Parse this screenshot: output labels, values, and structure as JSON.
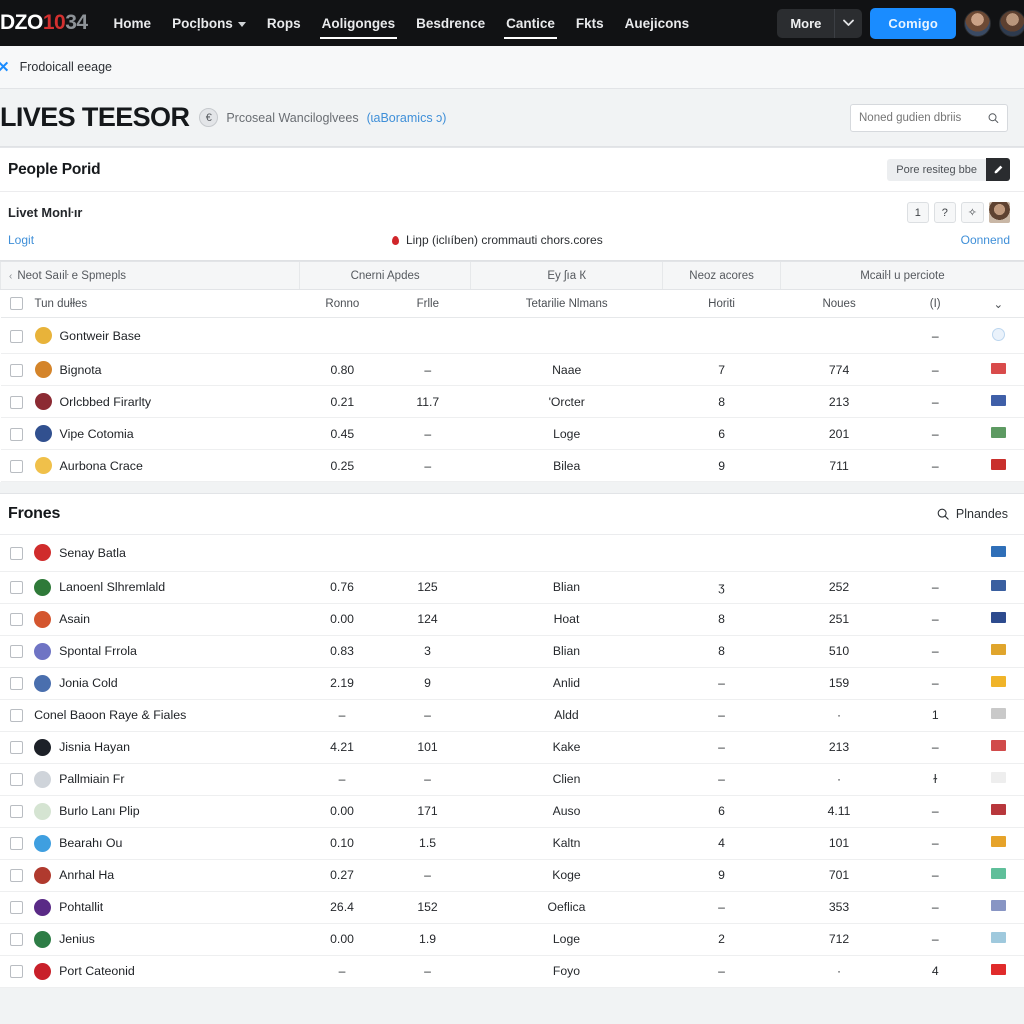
{
  "topnav": {
    "brand": {
      "part1": "DZO",
      "part2": "10",
      "part3": "34"
    },
    "links": [
      {
        "label": "Home",
        "active": false,
        "caret": false
      },
      {
        "label": "Pocḷbons",
        "active": false,
        "caret": true
      },
      {
        "label": "Rops",
        "active": false,
        "caret": false
      },
      {
        "label": "Aoligonges",
        "active": true,
        "caret": false
      },
      {
        "label": "Besdrence",
        "active": false,
        "caret": false
      },
      {
        "label": "Cantice",
        "active": true,
        "caret": false
      },
      {
        "label": "Fkts",
        "active": false,
        "caret": false
      },
      {
        "label": "Auejicons",
        "active": false,
        "caret": false
      }
    ],
    "more_label": "More",
    "cta_label": "Comigo",
    "avatar_name": "user-avatar",
    "avatar2_name": "secondary-avatar"
  },
  "notice": {
    "close_icon": "✕",
    "text": "Frodoicall eeage"
  },
  "titlebar": {
    "title": "LIVES TEESOR",
    "badge": "€",
    "subtitle": "Prcoseal Wanciloglvees",
    "link": "(ɩaBoramics ɔ)",
    "search_placeholder": "Noned gudien dbriis",
    "search_value": ""
  },
  "card1": {
    "heading": "People Porid",
    "chip_label": "Pore resiteg bbe",
    "chip_icon": "pencil-icon",
    "sub_heading": "Livet Monŀır",
    "mini_buttons": [
      "1",
      "?",
      "✧"
    ],
    "note_left": "Logit",
    "note_mid": "Liŋp (iclıíben) crommauti chors.cores",
    "note_right": "Oonnend"
  },
  "table": {
    "group_headers": [
      {
        "label": "Neot Saıiŀ e Spmepls",
        "chev": "‹"
      },
      {
        "label": "Cnerni Apdes"
      },
      {
        "label": "Ey ʃıа К"
      },
      {
        "label": "Neoz acores"
      },
      {
        "label": "Mcaiŀl u perciote"
      }
    ],
    "column_headers": {
      "checkbox": "",
      "name": "Tun dułłes",
      "num1": "Ronno",
      "num2": "Frlle",
      "team": "Tetarilie Nlmans",
      "h": "Horiti",
      "n": "Noues",
      "o": "(I)",
      "flag": "⌄"
    },
    "rows": [
      {
        "name": "Gontweir Base",
        "badge": "#e8b33a",
        "num1": "",
        "num2": "",
        "team": "",
        "h": "",
        "n": "",
        "o": "–",
        "flag": "#bcd6ef",
        "flagshape": "circle"
      },
      {
        "name": "Bignota",
        "badge": "#d4842a",
        "num1": "0.80",
        "num2": "–",
        "team": "Naae",
        "h": "7",
        "n": "774",
        "o": "–",
        "flag": "#d94b4b"
      },
      {
        "name": "Orlcbbed Firarlty",
        "badge": "#8c2b33",
        "num1": "0.21",
        "num2": "11.7",
        "team": "'Orcter",
        "h": "8",
        "n": "213",
        "o": "–",
        "flag": "#3f5fa8"
      },
      {
        "name": "Vipe Cotomia",
        "badge": "#31508f",
        "num1": "0.45",
        "num2": "–",
        "team": "Loge",
        "h": "6",
        "n": "201",
        "o": "–",
        "flag": "#5d9a62"
      },
      {
        "name": "Aurbona Crace",
        "badge": "#f0c04a",
        "num1": "0.25",
        "num2": "–",
        "team": "Bilea",
        "h": "9",
        "n": "711",
        "o": "–",
        "flag": "#c9302c"
      }
    ]
  },
  "card2": {
    "heading": "Frones",
    "action_label": "Plnandes",
    "action_icon": "search-icon",
    "rows": [
      {
        "name": "Senay Batla",
        "badge": "#d02c2c",
        "num1": "",
        "num2": "",
        "team": "",
        "h": "",
        "n": "",
        "o": "",
        "flag": "#2f6fb8"
      },
      {
        "name": "Lanoenl Slhremlald",
        "badge": "#2f7a39",
        "num1": "0.76",
        "num2": "125",
        "team": "Blian",
        "h": "ʒ",
        "n": "252",
        "o": "–",
        "flag": "#3a5fa0"
      },
      {
        "name": "Asain",
        "badge": "#d4562f",
        "num1": "0.00",
        "num2": "124",
        "team": "Hoat",
        "h": "8",
        "n": "251",
        "o": "–",
        "flag": "#2d4b8e",
        "num2_muted": true
      },
      {
        "name": "Spontal Frrola",
        "badge": "#6f74c4",
        "num1": "0.83",
        "num2": "3",
        "team": "Blian",
        "h": "8",
        "n": "510",
        "o": "–",
        "flag": "#e0a52c"
      },
      {
        "name": "Jonia Cold",
        "badge": "#4a6fae",
        "num1": "2.19",
        "num2": "9",
        "team": "Anlid",
        "h": "–",
        "n": "159",
        "o": "–",
        "flag": "#f0b429"
      },
      {
        "name": "Conel Baoon Raye & Fiales",
        "badge": "",
        "num1": "–",
        "num2": "–",
        "team": "Aldd",
        "h": "–",
        "n": "·",
        "o": "1",
        "flag": "#c9c9c9"
      },
      {
        "name": "Jisnia Hayan",
        "badge": "#1d2128",
        "num1": "4.21",
        "num2": "101",
        "team": "Kake",
        "h": "–",
        "n": "213",
        "o": "–",
        "flag": "#d14b4b",
        "num2_muted": true
      },
      {
        "name": "Pallmiain Fr",
        "badge": "#cfd4da",
        "num1": "–",
        "num2": "–",
        "team": "Clien",
        "h": "–",
        "n": "·",
        "o": "ɫ",
        "flag": "#eeeeee"
      },
      {
        "name": "Burlo Lanı Plip",
        "badge": "#d5e4d2",
        "num1": "0.00",
        "num2": "171",
        "team": "Auso",
        "h": "6",
        "n": "4.11",
        "o": "–",
        "flag": "#b8373c"
      },
      {
        "name": "Bearahı Ou",
        "badge": "#3f9fe0",
        "num1": "0.10",
        "num2": "1.5",
        "team": "Kaltn",
        "h": "4",
        "n": "101",
        "o": "–",
        "flag": "#e6a32a"
      },
      {
        "name": "Anrhal Ha",
        "badge": "#b03a2e",
        "num1": "0.27",
        "num2": "–",
        "team": "Koge",
        "h": "9",
        "n": "701",
        "o": "–",
        "flag": "#5fbf9a"
      },
      {
        "name": "Pohtallit",
        "badge": "#5a2a86",
        "num1": "26.4",
        "num2": "152",
        "team": "Oeflica",
        "h": "–",
        "n": "353",
        "o": "–",
        "flag": "#8895c4",
        "num2_muted": true
      },
      {
        "name": "Jenius",
        "badge": "#2e7d46",
        "num1": "0.00",
        "num2": "1.9",
        "team": "Loge",
        "h": "2",
        "n": "712",
        "o": "–",
        "flag": "#9fc9dd"
      },
      {
        "name": "Port Cateonid",
        "badge": "#c8202a",
        "num1": "–",
        "num2": "–",
        "team": "Foyo",
        "h": "–",
        "n": "·",
        "o": "4",
        "flag": "#e02b2b"
      }
    ]
  }
}
